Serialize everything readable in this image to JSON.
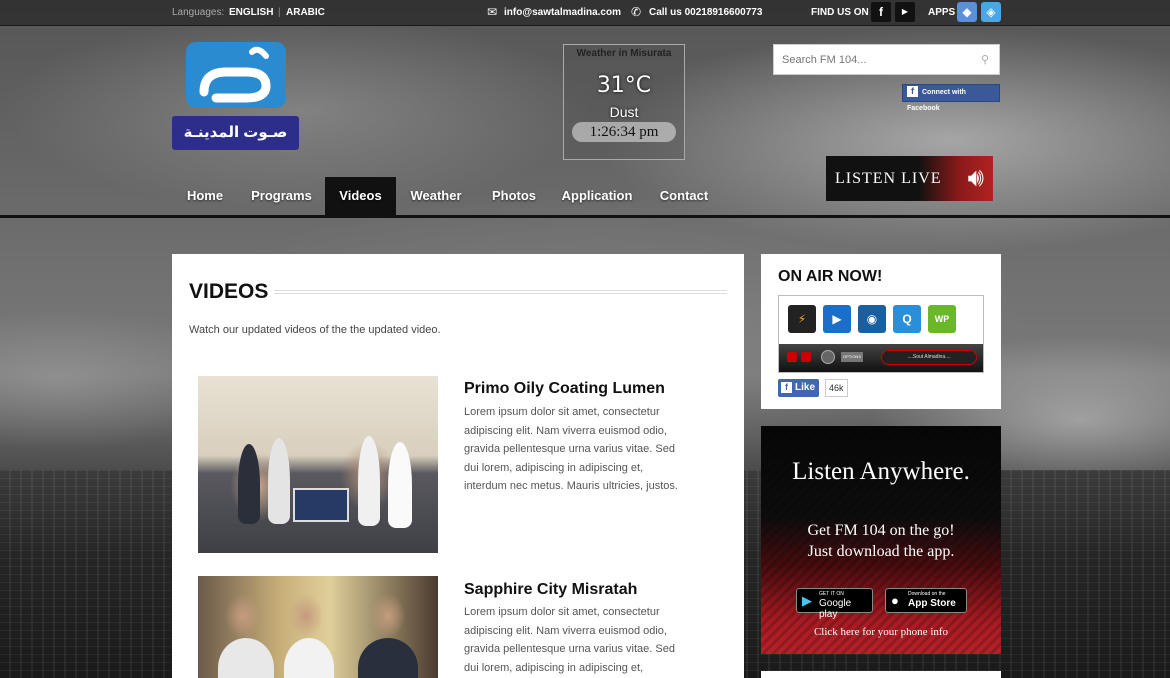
{
  "topbar": {
    "languages_label": "Languages:",
    "lang_english": "ENGLISH",
    "lang_separator": "|",
    "lang_arabic": "ARABIC",
    "email": "info@sawtalmadina.com",
    "phone": "Call us 00218916600773",
    "find_us": "FIND US ON",
    "apps": "APPS"
  },
  "logo": {
    "arabic_text": "صـوت المدينـة"
  },
  "weather": {
    "title": "Weather in Misurata",
    "temperature": "31°C",
    "condition": "Dust",
    "time": "1:26:34 pm"
  },
  "search": {
    "placeholder": "Search FM 104..."
  },
  "facebook_connect": "Connect with Facebook",
  "listen_live": "LISTEN LIVE",
  "nav": {
    "items": [
      {
        "label": "Home",
        "active": false
      },
      {
        "label": "Programs",
        "active": false
      },
      {
        "label": "Videos",
        "active": true
      },
      {
        "label": "Weather",
        "active": false
      },
      {
        "label": "Photos",
        "active": false
      },
      {
        "label": "Application",
        "active": false
      },
      {
        "label": "Contact",
        "active": false
      }
    ]
  },
  "main": {
    "title": "VIDEOS",
    "intro": "Watch our updated videos of the the updated video.",
    "videos": [
      {
        "title": "Primo Oily Coating Lumen",
        "text": "Lorem ipsum dolor sit amet, consectetur adipiscing elit. Nam viverra euismod odio, gravida pellentesque urna varius vitae. Sed dui lorem, adipiscing in adipiscing et, interdum nec metus. Mauris ultricies, justos."
      },
      {
        "title": "Sapphire City Misratah",
        "text": "Lorem ipsum dolor sit amet, consectetur adipiscing elit. Nam viverra euismod odio, gravida pellentesque urna varius vitae. Sed dui lorem, adipiscing in adipiscing et,"
      }
    ]
  },
  "onair": {
    "title": "ON AIR NOW!",
    "player_station": "....Sout Almadina....",
    "player_option": "OPTIONS",
    "like_label": "Like",
    "like_count": "46k"
  },
  "promo": {
    "title": "Listen Anywhere.",
    "line1": "Get FM 104 on the go!",
    "line2": "Just download the app.",
    "google_small": "GET IT ON",
    "google_big": "Google play",
    "apple_small": "Download on the",
    "apple_big": "App Store",
    "link": "Click here for your phone info"
  },
  "colors": {
    "accent_red": "#b7202a",
    "facebook_blue": "#3b5998",
    "logo_blue": "#2a8bd1",
    "logo_navy": "#2d2e8a"
  }
}
